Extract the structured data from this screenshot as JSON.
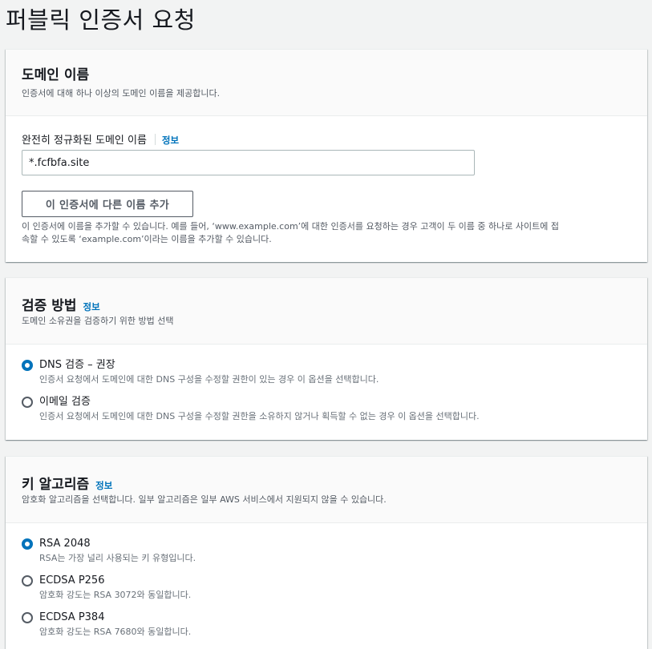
{
  "page": {
    "title": "퍼블릭 인증서 요청"
  },
  "domain_section": {
    "heading": "도메인 이름",
    "description": "인증서에 대해 하나 이상의 도메인 이름을 제공합니다.",
    "field_label": "완전히 정규화된 도메인 이름",
    "info_link": "정보",
    "domain_value": "*.fcfbfa.site",
    "add_button": "이 인증서에 다른 이름 추가",
    "help_line1": "이 인증서에 이름을 추가할 수 있습니다. 예를 들어, ‘www.example.com’에 대한 인증서를 요청하는 경우 고객이 두 이름 중 하나로 사이트에 접",
    "help_line2": "속할 수 있도록 ‘example.com’이라는 이름을 추가할 수 있습니다."
  },
  "validation_section": {
    "heading": "검증 방법",
    "info_link": "정보",
    "description": "도메인 소유권을 검증하기 위한 방법 선택",
    "options": [
      {
        "label": "DNS 검증 – 권장",
        "description": "인증서 요청에서 도메인에 대한 DNS 구성을 수정할 권한이 있는 경우 이 옵션을 선택합니다.",
        "selected": true
      },
      {
        "label": "이메일 검증",
        "description": "인증서 요청에서 도메인에 대한 DNS 구성을 수정할 권한을 소유하지 않거나 획득할 수 없는 경우 이 옵션을 선택합니다.",
        "selected": false
      }
    ]
  },
  "key_section": {
    "heading": "키 알고리즘",
    "info_link": "정보",
    "description": "암호화 알고리즘을 선택합니다. 일부 알고리즘은 일부 AWS 서비스에서 지원되지 않을 수 있습니다.",
    "options": [
      {
        "label": "RSA 2048",
        "description": "RSA는 가장 널리 사용되는 키 유형입니다.",
        "selected": true
      },
      {
        "label": "ECDSA P256",
        "description": "암호화 강도는 RSA 3072와 동일합니다.",
        "selected": false
      },
      {
        "label": "ECDSA P384",
        "description": "암호화 강도는 RSA 7680와 동일합니다.",
        "selected": false
      }
    ]
  },
  "colors": {
    "accent": "#0073bb",
    "background": "#f2f3f3",
    "text": "#16191f",
    "muted": "#545b64"
  }
}
